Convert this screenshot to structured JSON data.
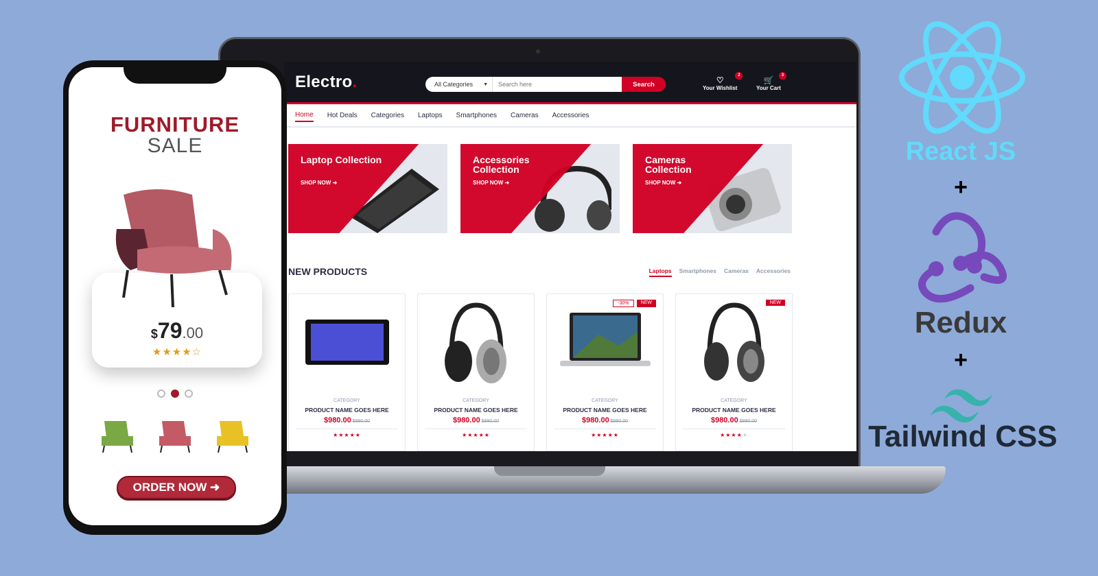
{
  "store": {
    "logo": "Electro",
    "logo_dot": ".",
    "search": {
      "category": "All Categories",
      "placeholder": "Search here",
      "button": "Search"
    },
    "wishlist": {
      "label": "Your Wishlist",
      "count": "2"
    },
    "cart": {
      "label": "Your Cart",
      "count": "3"
    },
    "nav": [
      "Home",
      "Hot Deals",
      "Categories",
      "Laptops",
      "Smartphones",
      "Cameras",
      "Accessories"
    ],
    "collections": [
      {
        "title": "Laptop Collection",
        "cta": "SHOP NOW ➜"
      },
      {
        "title": "Accessories Collection",
        "cta": "SHOP NOW ➜"
      },
      {
        "title": "Cameras Collection",
        "cta": "SHOP NOW ➜"
      }
    ],
    "new_products": {
      "title": "NEW PRODUCTS",
      "tabs": [
        "Laptops",
        "Smartphones",
        "Cameras",
        "Accessories"
      ],
      "items": [
        {
          "category": "CATEGORY",
          "name": "PRODUCT NAME GOES HERE",
          "price": "$980.00",
          "old_price": "$990.00",
          "rating": 5,
          "sale": "",
          "new": "",
          "image": "tablet"
        },
        {
          "category": "CATEGORY",
          "name": "PRODUCT NAME GOES HERE",
          "price": "$980.00",
          "old_price": "$990.00",
          "rating": 5,
          "sale": "",
          "new": "",
          "image": "headphones-silver"
        },
        {
          "category": "CATEGORY",
          "name": "PRODUCT NAME GOES HERE",
          "price": "$980.00",
          "old_price": "$990.00",
          "rating": 5,
          "sale": "-30%",
          "new": "NEW",
          "image": "laptop"
        },
        {
          "category": "CATEGORY",
          "name": "PRODUCT NAME GOES HERE",
          "price": "$980.00",
          "old_price": "$990.00",
          "rating": 4,
          "sale": "",
          "new": "NEW",
          "image": "headphones-black"
        }
      ]
    }
  },
  "phone": {
    "title": "FURNITURE",
    "subtitle": "SALE",
    "price_currency": "$",
    "price_main": "79",
    "price_cents": ".00",
    "rating": 4,
    "order_button": "ORDER NOW ➜",
    "carousel_active": 1,
    "thumb_colors": [
      "#7aa844",
      "#c45a66",
      "#e8c125"
    ]
  },
  "tech": {
    "react": "React JS",
    "plus": "+",
    "redux": "Redux",
    "tailwind": "Tailwind CSS"
  },
  "colors": {
    "accent": "#d10024",
    "header_bg": "#15161d",
    "page_bg": "#8eaad8",
    "react": "#61dafb",
    "redux": "#764abc",
    "tailwind": "#38b2ac"
  }
}
